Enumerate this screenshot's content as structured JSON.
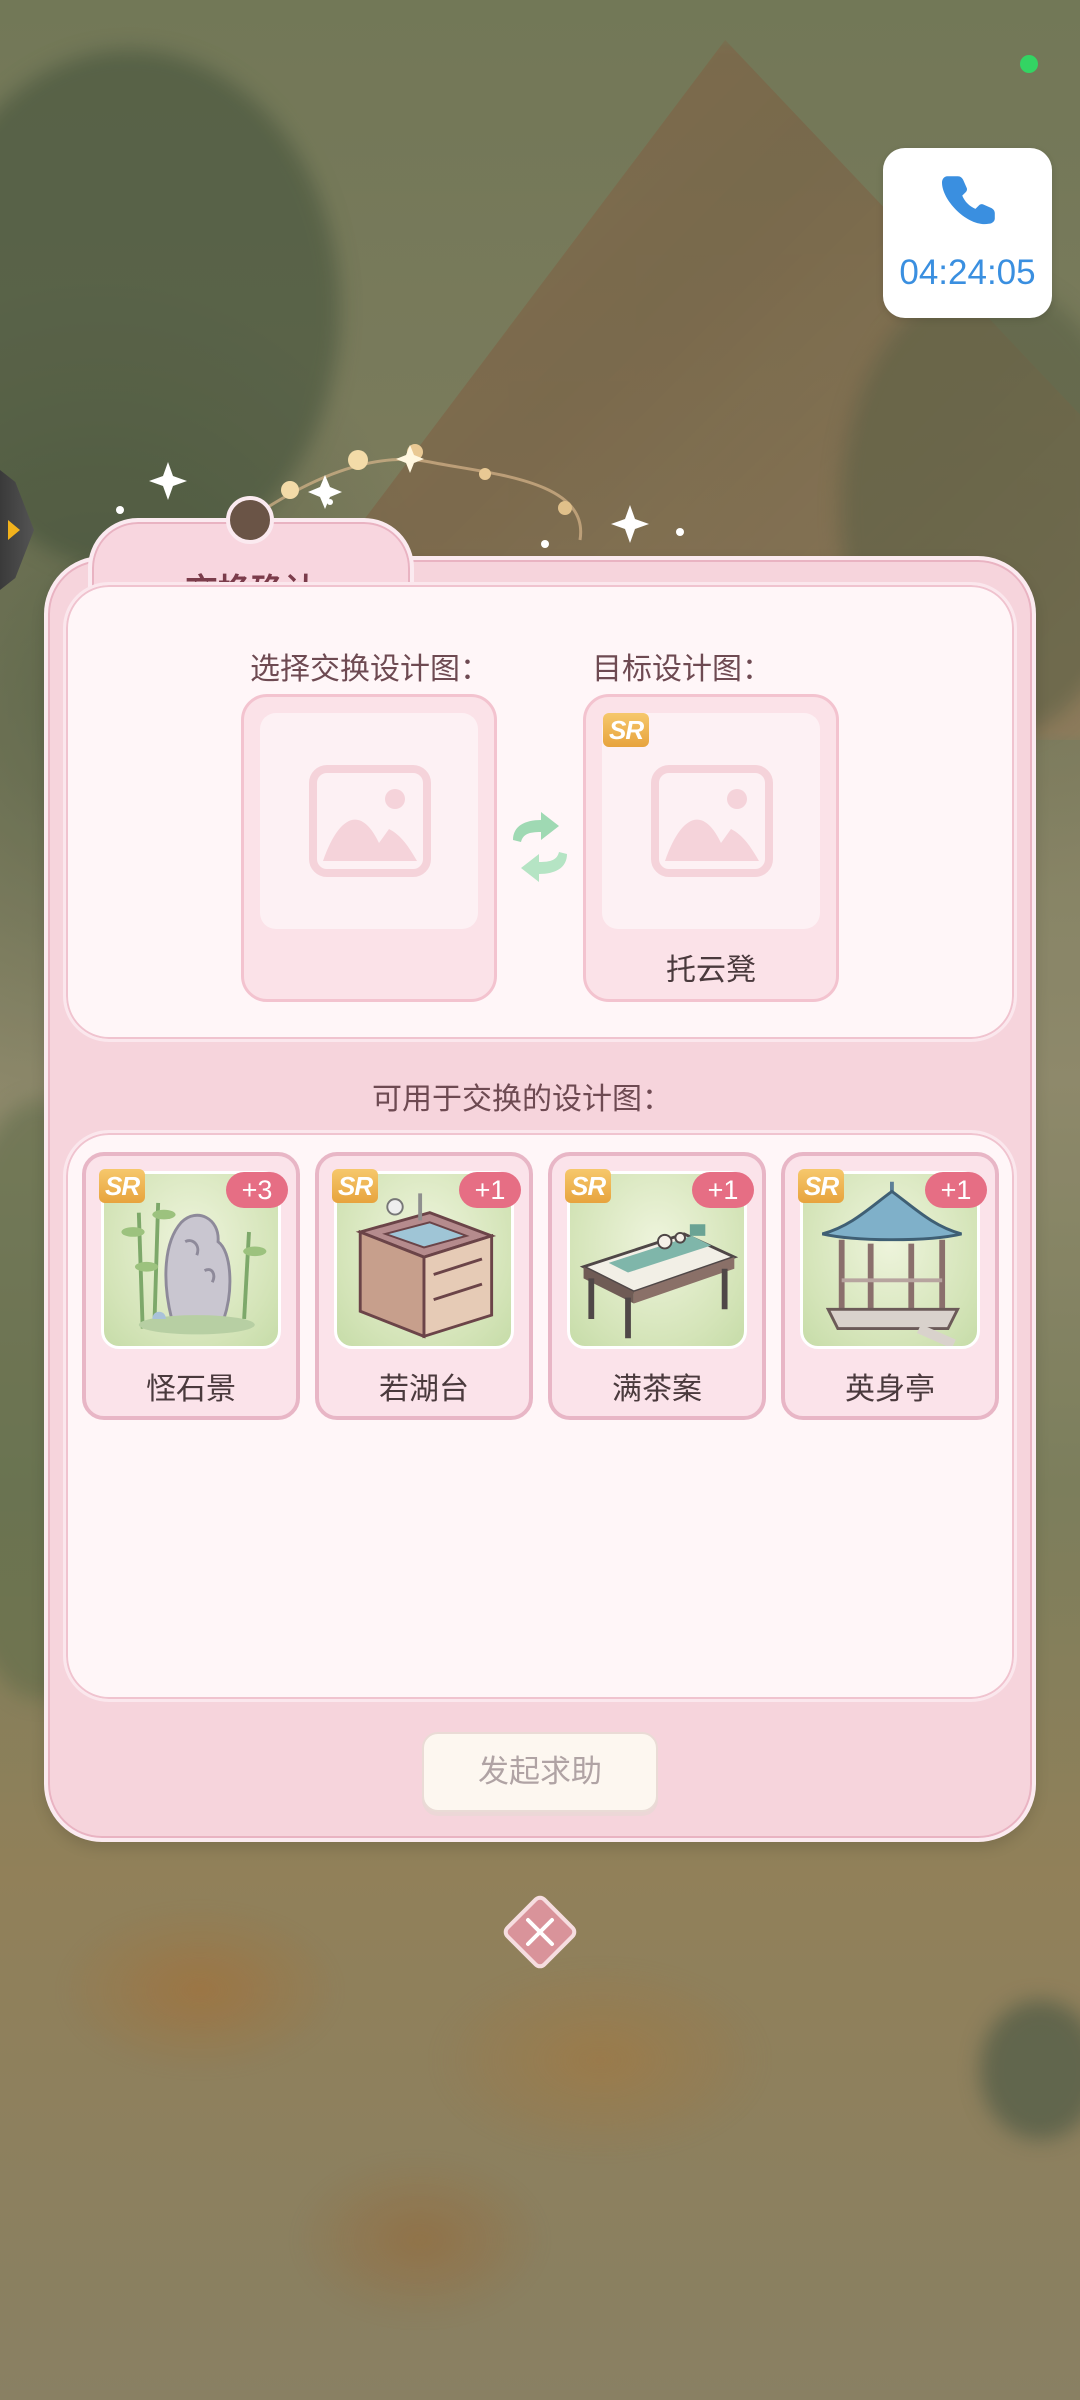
{
  "status": {
    "indicator": "green-dot"
  },
  "call": {
    "icon": "phone-icon",
    "timer": "04:24:05",
    "color": "#3a8fe0"
  },
  "dialog": {
    "title": "交换确认",
    "select_label": "选择交换设计图：",
    "target_label": "目标设计图：",
    "swap_icon": "swap-arrows-icon",
    "source_slot": {
      "empty": true,
      "icon": "image-placeholder-icon"
    },
    "target_slot": {
      "rarity": "SR",
      "name": "托云凳",
      "icon": "image-placeholder-icon"
    },
    "available_label": "可用于交换的设计图：",
    "available_items": [
      {
        "rarity": "SR",
        "count": "+3",
        "name": "怪石景",
        "icon": "rock-garden-icon"
      },
      {
        "rarity": "SR",
        "count": "+1",
        "name": "若湖台",
        "icon": "sink-cabinet-icon"
      },
      {
        "rarity": "SR",
        "count": "+1",
        "name": "满茶案",
        "icon": "tea-table-icon"
      },
      {
        "rarity": "SR",
        "count": "+1",
        "name": "英身亭",
        "icon": "pavilion-icon"
      }
    ],
    "help_button": "发起求助",
    "close_icon": "close-icon"
  },
  "colors": {
    "dialog_bg": "#f6d4dc",
    "panel_bg": "#fff6f8",
    "count_badge": "#e66e84",
    "sr_badge": "#e7a33d"
  }
}
